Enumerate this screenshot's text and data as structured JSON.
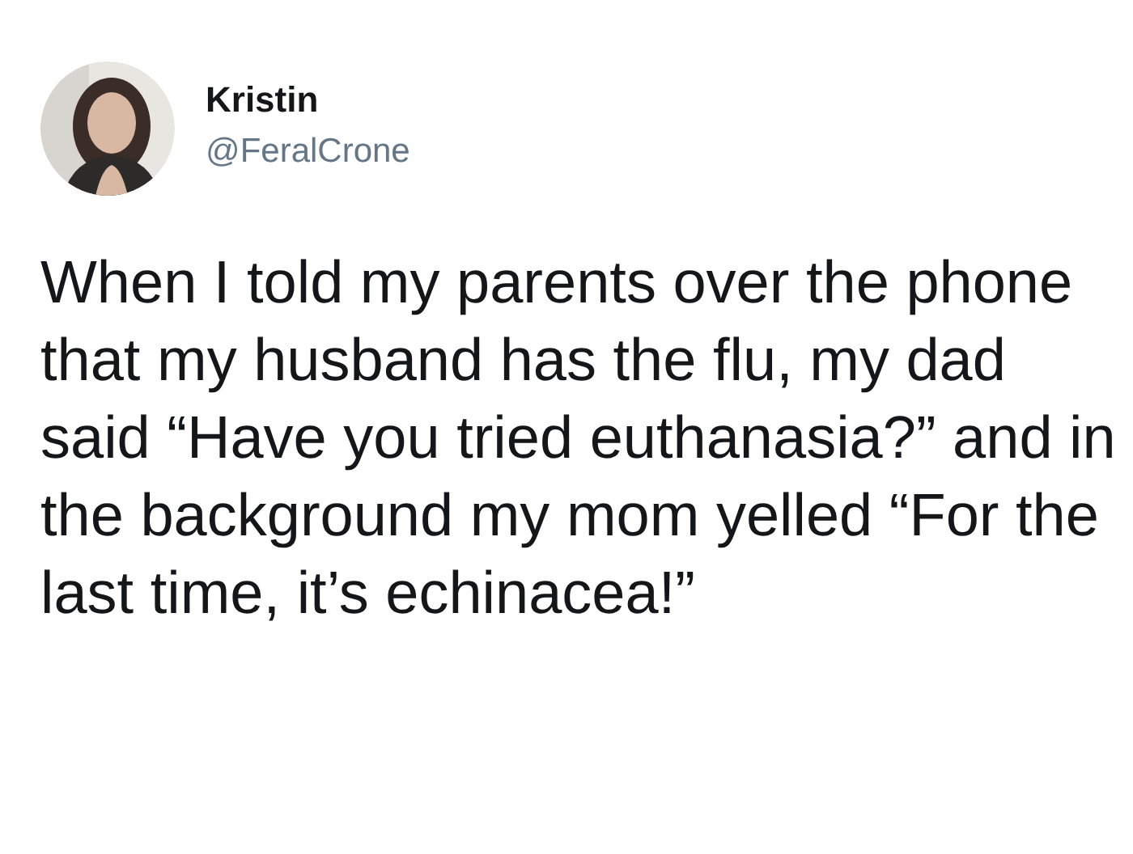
{
  "author": {
    "name": "Kristin",
    "handle": "@FeralCrone"
  },
  "text": "When I told my parents over the phone that my husband has the flu, my dad said “Have you tried euthanasia?” and in the background my mom yelled “For the last time, it’s echinacea!”"
}
